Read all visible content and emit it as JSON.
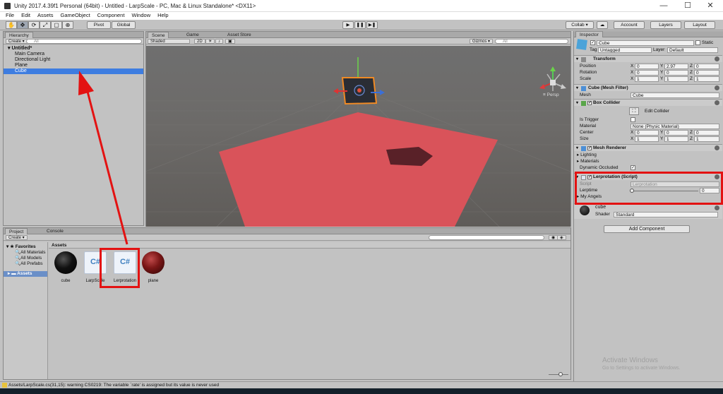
{
  "window": {
    "title": "Unity 2017.4.39f1 Personal (64bit) - Untitled - LarpScale - PC, Mac & Linux Standalone* <DX11>",
    "minimize": "—",
    "maximize": "☐",
    "close": "✕"
  },
  "menu": [
    "File",
    "Edit",
    "Assets",
    "GameObject",
    "Component",
    "Window",
    "Help"
  ],
  "toolbar": {
    "tools": [
      "✋",
      "✥",
      "⟳",
      "⤢",
      "▢",
      "⊕"
    ],
    "pivot": "Pivot",
    "global": "Global",
    "play": "▶",
    "pause": "❚❚",
    "step": "▶❚",
    "collab": "Collab ▾",
    "cloud": "☁",
    "account": "Account",
    "layers": "Layers",
    "layout": "Layout"
  },
  "hierarchy": {
    "tab": "Hierarchy",
    "create": "Create ▾",
    "search_placeholder": "All",
    "scene": "Untitled*",
    "items": [
      "Main Camera",
      "Directional Light",
      "Plane",
      "Cube"
    ],
    "selected": "Cube"
  },
  "scene": {
    "tabs": [
      "Scene",
      "Game",
      "Asset Store"
    ],
    "shading": "Shaded",
    "mode2d": "2D",
    "gizmos": "Gizmos ▾",
    "search_placeholder": "All",
    "persp": "Persp"
  },
  "project": {
    "tabs": [
      "Project",
      "Console"
    ],
    "create": "Create ▾",
    "favorites_title": "Favorites",
    "favorites": [
      "All Materials",
      "All Models",
      "All Prefabs"
    ],
    "assets_root": "Assets",
    "breadcrumb": "Assets",
    "assets": [
      {
        "name": "cube",
        "kind": "material-black"
      },
      {
        "name": "LarpScale",
        "kind": "script"
      },
      {
        "name": "Lerprotation",
        "kind": "script"
      },
      {
        "name": "plane",
        "kind": "material-red"
      }
    ]
  },
  "status": {
    "message": "Assets/LarpScale.cs(31,15): warning CS0219: The variable `rate' is assigned but its value is never used"
  },
  "inspector": {
    "tab": "Inspector",
    "object_name": "Cube",
    "static_label": "Static",
    "tag_label": "Tag",
    "tag_value": "Untagged",
    "layer_label": "Layer",
    "layer_value": "Default",
    "transform": {
      "title": "Transform",
      "position_label": "Position",
      "rotation_label": "Rotation",
      "scale_label": "Scale",
      "position": {
        "x": "0",
        "y": "2.97",
        "z": "0"
      },
      "rotation": {
        "x": "0",
        "y": "0",
        "z": "0"
      },
      "scale": {
        "x": "1",
        "y": "1",
        "z": "1"
      }
    },
    "mesh_filter": {
      "title": "Cube (Mesh Filter)",
      "mesh_label": "Mesh",
      "mesh_value": "Cube"
    },
    "box_collider": {
      "title": "Box Collider",
      "edit_button": "Edit Collider",
      "is_trigger_label": "Is Trigger",
      "material_label": "Material",
      "material_value": "None (Physic Material)",
      "center_label": "Center",
      "center": {
        "x": "0",
        "y": "0",
        "z": "0"
      },
      "size_label": "Size",
      "size": {
        "x": "1",
        "y": "1",
        "z": "1"
      }
    },
    "mesh_renderer": {
      "title": "Mesh Renderer",
      "lighting": "Lighting",
      "materials": "Materials",
      "dynamic_occluded": "Dynamic Occluded"
    },
    "lerprotation": {
      "title": "Lerprotation (Script)",
      "script_label": "Script",
      "script_value": "Lerprotation",
      "lerptime_label": "Lerptime",
      "lerptime_value": "0",
      "lerptime_fraction": 0,
      "angels_label": "My Angels"
    },
    "material": {
      "name": "cube",
      "shader_label": "Shader",
      "shader_value": "Standard"
    },
    "add_component": "Add Component"
  },
  "watermark": {
    "title": "Activate Windows",
    "subtitle": "Go to Settings to activate Windows."
  },
  "axis_letters": {
    "x": "X",
    "y": "Y",
    "z": "Z"
  },
  "colors": {
    "selection": "#3e7de0",
    "annotation": "#e31212",
    "plane": "#d9535a"
  }
}
